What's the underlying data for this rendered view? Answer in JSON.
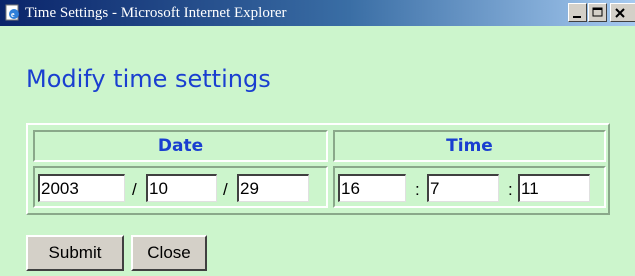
{
  "window": {
    "title": "Time Settings - Microsoft Internet Explorer",
    "icon": "ie-page-icon",
    "controls": [
      "minimize-icon",
      "maximize-icon",
      "close-icon"
    ]
  },
  "page": {
    "heading": "Modify time settings"
  },
  "date": {
    "header": "Date",
    "year": "2003",
    "month": "10",
    "day": "29",
    "separator": "/"
  },
  "time": {
    "header": "Time",
    "hour": "16",
    "minute": "7",
    "second": "11",
    "separator": ":"
  },
  "buttons": {
    "submit": "Submit",
    "close": "Close"
  },
  "colors": {
    "background": "#ccf5cc",
    "heading": "#1a3fd0",
    "titlebar_start": "#0a246a",
    "titlebar_end": "#a6caf0"
  }
}
